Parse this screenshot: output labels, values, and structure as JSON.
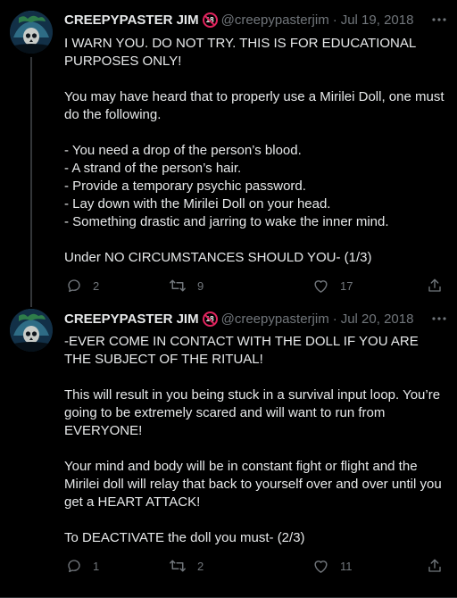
{
  "colors": {
    "background": "#000000",
    "text": "#e7e9ea",
    "muted": "#71767b",
    "badge": "#e0245e",
    "divider": "#2f3336"
  },
  "tweets": [
    {
      "display_name": "CREEPYPASTER JIM",
      "badge_icon": "no-under-18-icon",
      "badge_text": "18",
      "handle": "@creepypasterjim",
      "separator": "·",
      "date": "Jul 19, 2018",
      "lines": [
        "I WARN YOU. DO NOT TRY. THIS IS FOR EDUCATIONAL PURPOSES ONLY!",
        "",
        "You may have heard that to properly use a Mirilei Doll, one must do the following.",
        "",
        "- You need a drop of the person’s blood.",
        "- A strand of the person’s hair.",
        "- Provide a temporary psychic password.",
        "- Lay down with the Mirilei Doll on your head.",
        "- Something drastic and jarring to wake the inner mind.",
        "",
        "Under NO CIRCUMSTANCES SHOULD YOU- (1/3)"
      ],
      "reply_count": "2",
      "retweet_count": "9",
      "like_count": "17"
    },
    {
      "display_name": "CREEPYPASTER JIM",
      "badge_icon": "no-under-18-icon",
      "badge_text": "18",
      "handle": "@creepypasterjim",
      "separator": "·",
      "date": "Jul 20, 2018",
      "lines": [
        "-EVER COME IN CONTACT WITH THE DOLL IF YOU ARE THE SUBJECT OF THE RITUAL!",
        "",
        "This will result in you being stuck in a survival input loop. You’re going to be extremely scared and will want to run from EVERYONE!",
        "",
        "Your mind and body will be in constant fight or flight and the Mirilei doll will relay that back to yourself over and over until you get a HEART ATTACK!",
        "",
        "To DEACTIVATE the doll you must- (2/3)"
      ],
      "reply_count": "1",
      "retweet_count": "2",
      "like_count": "11"
    }
  ]
}
